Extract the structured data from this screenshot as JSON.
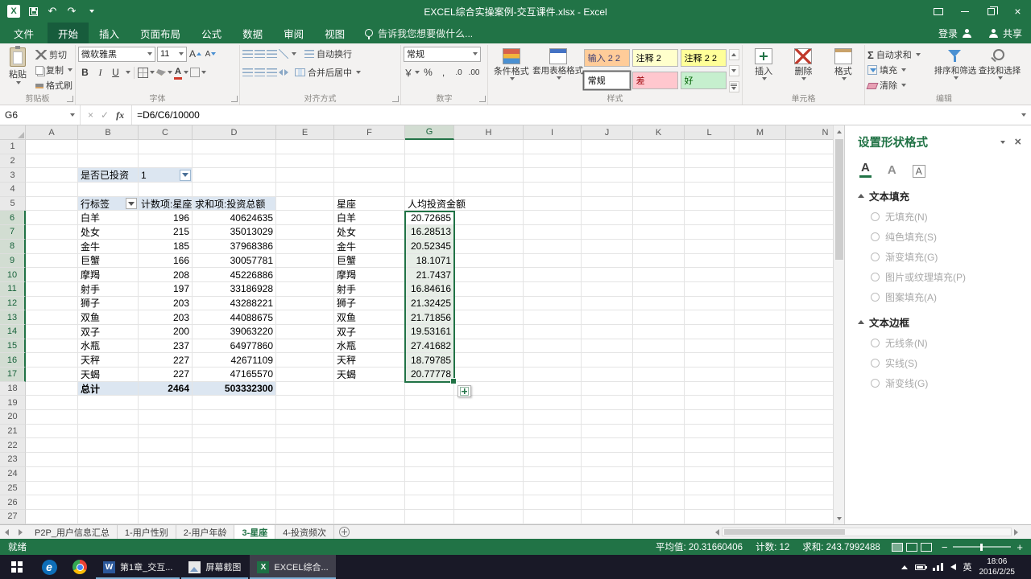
{
  "colors": {
    "accent_green": "#217346",
    "pivot_fill": "#dce6f1",
    "selection_fill": "#e7eee7",
    "status_bar": "#217346"
  },
  "icons": {
    "undo": "↶",
    "redo": "↷",
    "close": "×",
    "cancel": "×",
    "check": "✓",
    "fx": "fx",
    "sum": "Σ",
    "bold": "B",
    "italic": "I",
    "underline": "U",
    "currency": "￥",
    "percent": "%",
    "comma": ",",
    "inc_decimal": ".0",
    "dec_decimal": ".00",
    "minus": "−",
    "plus": "+",
    "excel_letter": "X"
  },
  "title_bar": {
    "title": "EXCEL综合实操案例-交互课件.xlsx - Excel"
  },
  "ribbon": {
    "file_tab": "文件",
    "tabs": [
      "开始",
      "插入",
      "页面布局",
      "公式",
      "数据",
      "审阅",
      "视图"
    ],
    "active_tab": "开始",
    "tell_me": "告诉我您想要做什么...",
    "sign_in": "登录",
    "share": "共享",
    "clipboard": {
      "label": "剪贴板",
      "paste": "粘贴",
      "cut": "剪切",
      "copy": "复制",
      "format_painter": "格式刷"
    },
    "font": {
      "label": "字体",
      "name": "微软雅黑",
      "size": "11"
    },
    "alignment": {
      "label": "对齐方式",
      "wrap_text": "自动换行",
      "merge_center": "合并后居中"
    },
    "number": {
      "label": "数字",
      "format": "常规"
    },
    "styles": {
      "label": "样式",
      "conditional": "条件格式",
      "format_as_table": "套用表格格式",
      "gallery": [
        {
          "label": "输入 2 2",
          "bg": "#FFCC99",
          "fg": "#3F3F76",
          "selected": false
        },
        {
          "label": "注释 2",
          "bg": "#FFFFCC",
          "fg": "#000000",
          "selected": false
        },
        {
          "label": "注释 2 2",
          "bg": "#FFFF99",
          "fg": "#000000",
          "selected": false
        },
        {
          "label": "常规",
          "bg": "#FFFFFF",
          "fg": "#000000",
          "selected": true
        },
        {
          "label": "差",
          "bg": "#FFC7CE",
          "fg": "#9C0006",
          "selected": false
        },
        {
          "label": "好",
          "bg": "#C6EFCE",
          "fg": "#006100",
          "selected": false
        }
      ]
    },
    "cells": {
      "label": "单元格",
      "insert": "插入",
      "delete": "删除",
      "format": "格式"
    },
    "editing": {
      "label": "编辑",
      "autosum": "自动求和",
      "fill": "填充",
      "clear": "清除",
      "sort_filter": "排序和筛选",
      "find_select": "查找和选择"
    }
  },
  "formula_bar": {
    "name_box": "G6",
    "formula": "=D6/C6/10000"
  },
  "grid": {
    "columns": [
      "A",
      "B",
      "C",
      "D",
      "E",
      "F",
      "G",
      "H",
      "I",
      "J",
      "K",
      "L",
      "M",
      "N"
    ],
    "row_count": 27,
    "selected_column": "G",
    "selected_row_start": 6,
    "selected_row_end": 17,
    "filter_label": "是否已投资",
    "filter_value": "1",
    "pivot": {
      "headers": [
        "行标签",
        "计数项:星座",
        "求和项:投资总额"
      ],
      "rows": [
        [
          "白羊",
          "196",
          "40624635"
        ],
        [
          "处女",
          "215",
          "35013029"
        ],
        [
          "金牛",
          "185",
          "37968386"
        ],
        [
          "巨蟹",
          "166",
          "30057781"
        ],
        [
          "摩羯",
          "208",
          "45226886"
        ],
        [
          "射手",
          "197",
          "33186928"
        ],
        [
          "狮子",
          "203",
          "43288221"
        ],
        [
          "双鱼",
          "203",
          "44088675"
        ],
        [
          "双子",
          "200",
          "39063220"
        ],
        [
          "水瓶",
          "237",
          "64977860"
        ],
        [
          "天秤",
          "227",
          "42671109"
        ],
        [
          "天蝎",
          "227",
          "47165570"
        ]
      ],
      "total": [
        "总计",
        "2464",
        "503332300"
      ]
    },
    "capita": {
      "headers": [
        "星座",
        "人均投资金额"
      ],
      "rows": [
        [
          "白羊",
          "20.72685"
        ],
        [
          "处女",
          "16.28513"
        ],
        [
          "金牛",
          "20.52345"
        ],
        [
          "巨蟹",
          "18.1071"
        ],
        [
          "摩羯",
          "21.7437"
        ],
        [
          "射手",
          "16.84616"
        ],
        [
          "狮子",
          "21.32425"
        ],
        [
          "双鱼",
          "21.71856"
        ],
        [
          "双子",
          "19.53161"
        ],
        [
          "水瓶",
          "27.41682"
        ],
        [
          "天秤",
          "18.79785"
        ],
        [
          "天蝎",
          "20.77778"
        ]
      ]
    }
  },
  "task_pane": {
    "title": "设置形状格式",
    "sections": [
      {
        "header": "文本填充",
        "options": [
          "无填充(N)",
          "纯色填充(S)",
          "渐变填充(G)",
          "图片或纹理填充(P)",
          "图案填充(A)"
        ]
      },
      {
        "header": "文本边框",
        "options": [
          "无线条(N)",
          "实线(S)",
          "渐变线(G)"
        ]
      }
    ]
  },
  "sheet_bar": {
    "tabs": [
      "P2P_用户信息汇总",
      "1-用户性别",
      "2-用户年龄",
      "3-星座",
      "4-投资频次"
    ],
    "active": "3-星座"
  },
  "status_bar": {
    "mode": "就绪",
    "average": "平均值: 20.31660406",
    "count": "计数: 12",
    "sum": "求和: 243.7992488"
  },
  "taskbar": {
    "buttons": [
      {
        "label": "第1章_交互...",
        "app": "word",
        "active": false
      },
      {
        "label": "屏幕截图",
        "app": "image",
        "active": false
      },
      {
        "label": "EXCEL综合...",
        "app": "excel",
        "active": true
      }
    ],
    "language": "英",
    "time": "18:06",
    "date": "2016/2/25"
  }
}
